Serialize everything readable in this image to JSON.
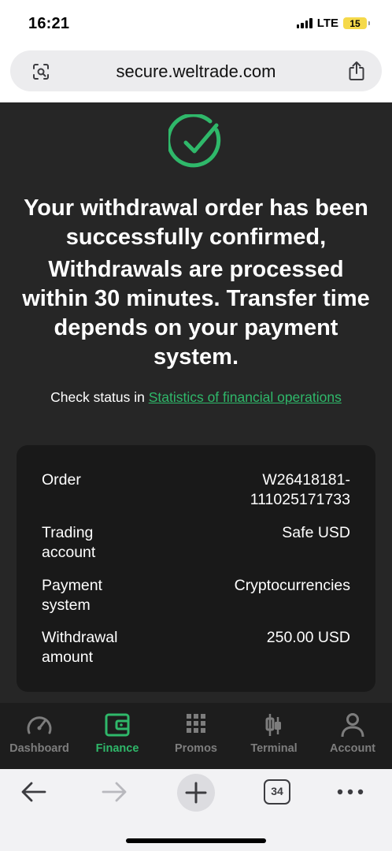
{
  "status_bar": {
    "time": "16:21",
    "network": "LTE",
    "battery": "15"
  },
  "browser": {
    "url": "secure.weltrade.com",
    "tab_count": "34"
  },
  "success": {
    "headline_1": "Your withdrawal order has been successfully confirmed,",
    "headline_2": "Withdrawals are processed within 30 minutes. Transfer time depends on your payment system.",
    "status_prefix": "Check status in",
    "status_link": "Statistics of financial operations"
  },
  "order": {
    "order_label": "Order",
    "order_value_1": "W26418181-",
    "order_value_2": "111025171733",
    "account_label": "Trading account",
    "account_value": "Safe USD",
    "payment_label": "Payment system",
    "payment_value": "Cryptocurrencies",
    "amount_label": "Withdrawal amount",
    "amount_value": "250.00 USD"
  },
  "nav": {
    "dashboard": "Dashboard",
    "finance": "Finance",
    "promos": "Promos",
    "terminal": "Terminal",
    "account": "Account"
  },
  "colors": {
    "accent": "#2fb86a",
    "background": "#262626",
    "card": "#191919",
    "nav_bg": "#1d1d1d",
    "nav_inactive": "#7d7d7d"
  },
  "icons": {
    "success": "check-circle-icon",
    "dashboard": "speedometer-icon",
    "finance": "wallet-icon",
    "promos": "grid-icon",
    "terminal": "candlestick-icon",
    "account": "user-icon"
  }
}
